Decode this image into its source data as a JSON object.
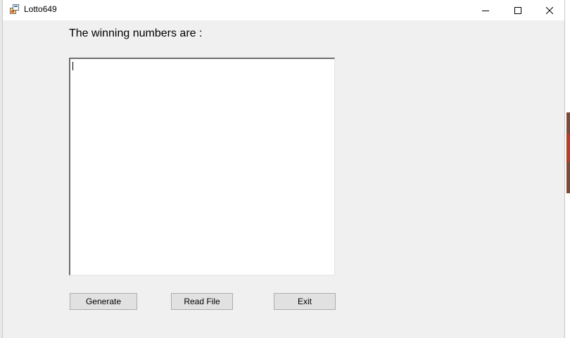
{
  "window": {
    "title": "Lotto649",
    "controls": {
      "minimize_icon": "minimize-icon",
      "maximize_icon": "maximize-icon",
      "close_icon": "close-icon"
    }
  },
  "form": {
    "label": "The winning numbers are :",
    "output_text": "",
    "buttons": {
      "generate": "Generate",
      "read_file": "Read File",
      "exit": "Exit"
    }
  },
  "colors": {
    "window_bg": "#f0f0f0",
    "titlebar_bg": "#ffffff",
    "button_bg": "#e1e1e1",
    "button_border": "#adadad"
  }
}
